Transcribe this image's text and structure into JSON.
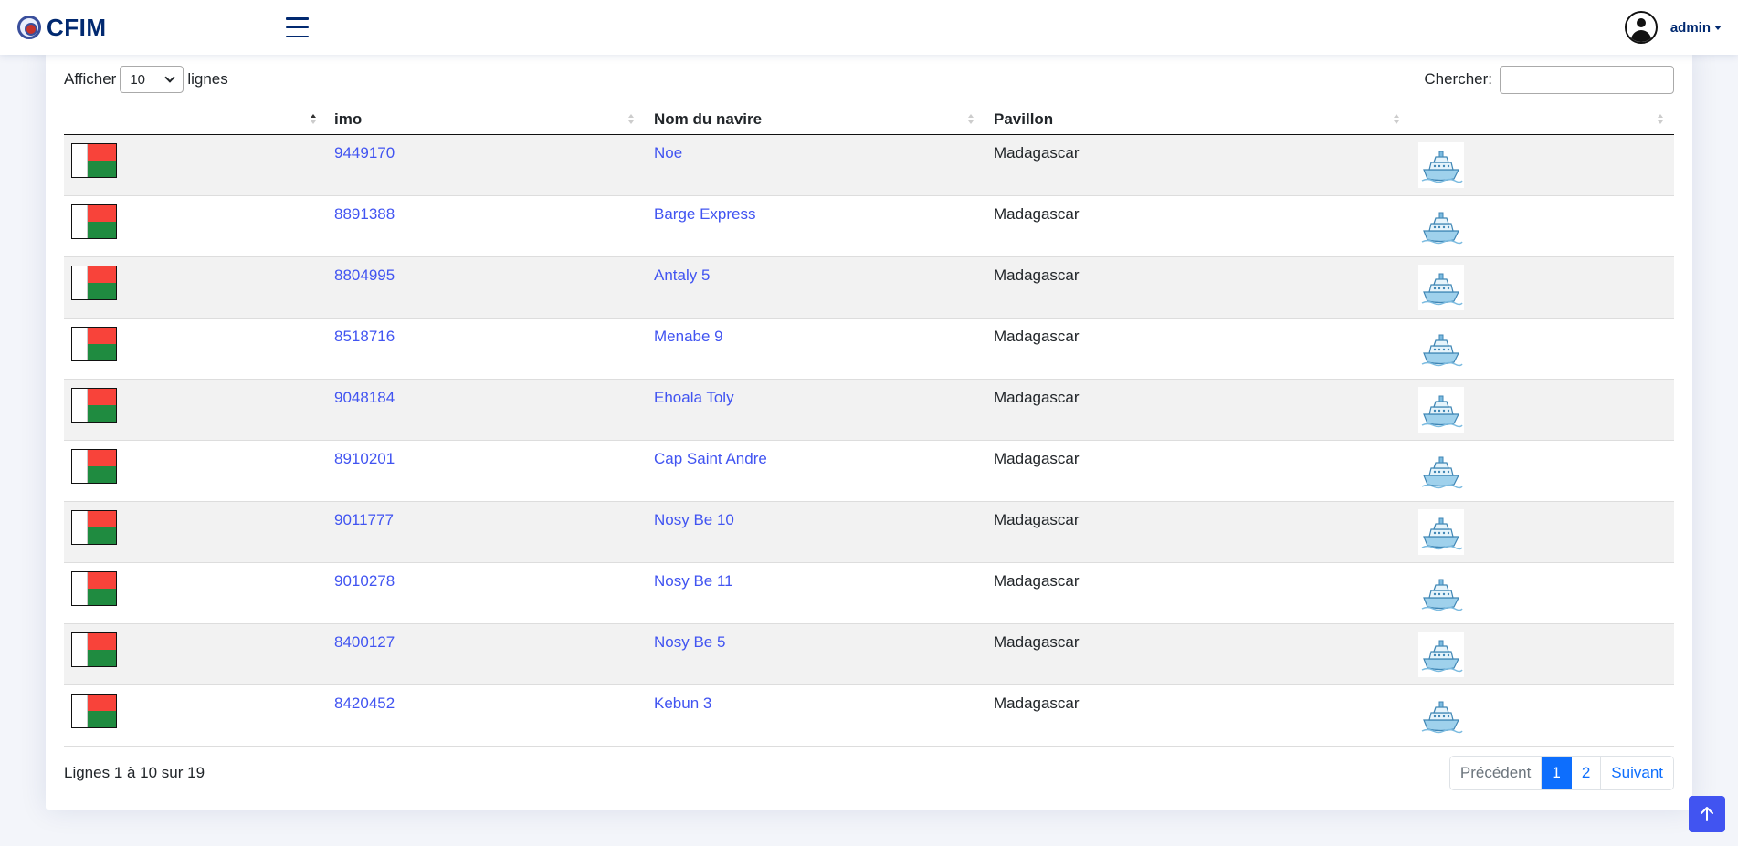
{
  "header": {
    "brand": "CFIM",
    "user_name": "admin"
  },
  "table_controls": {
    "show_label": "Afficher",
    "page_length": "10",
    "rows_label": "lignes",
    "search_label": "Chercher:",
    "search_value": ""
  },
  "table": {
    "columns": [
      "",
      "imo",
      "Nom du navire",
      "Pavillon",
      ""
    ],
    "rows": [
      {
        "imo": "9449170",
        "name": "Noe",
        "flag": "Madagascar"
      },
      {
        "imo": "8891388",
        "name": "Barge Express",
        "flag": "Madagascar"
      },
      {
        "imo": "8804995",
        "name": "Antaly 5",
        "flag": "Madagascar"
      },
      {
        "imo": "8518716",
        "name": "Menabe 9",
        "flag": "Madagascar"
      },
      {
        "imo": "9048184",
        "name": "Ehoala Toly",
        "flag": "Madagascar"
      },
      {
        "imo": "8910201",
        "name": "Cap Saint Andre",
        "flag": "Madagascar"
      },
      {
        "imo": "9011777",
        "name": "Nosy Be 10",
        "flag": "Madagascar"
      },
      {
        "imo": "9010278",
        "name": "Nosy Be 11",
        "flag": "Madagascar"
      },
      {
        "imo": "8400127",
        "name": "Nosy Be 5",
        "flag": "Madagascar"
      },
      {
        "imo": "8420452",
        "name": "Kebun 3",
        "flag": "Madagascar"
      }
    ],
    "row_icons": {
      "flag": "madagascar-flag-icon",
      "ship": "ship-icon"
    }
  },
  "footer": {
    "info": "Lignes 1 à 10 sur 19",
    "prev": "Précédent",
    "pages": [
      "1",
      "2"
    ],
    "current_page": "1",
    "next": "Suivant"
  },
  "colors": {
    "accent": "#4154f1",
    "brand": "#012970",
    "active_page": "#0d6efd",
    "flag_red": "#f8433a",
    "flag_green": "#1f8b40"
  }
}
